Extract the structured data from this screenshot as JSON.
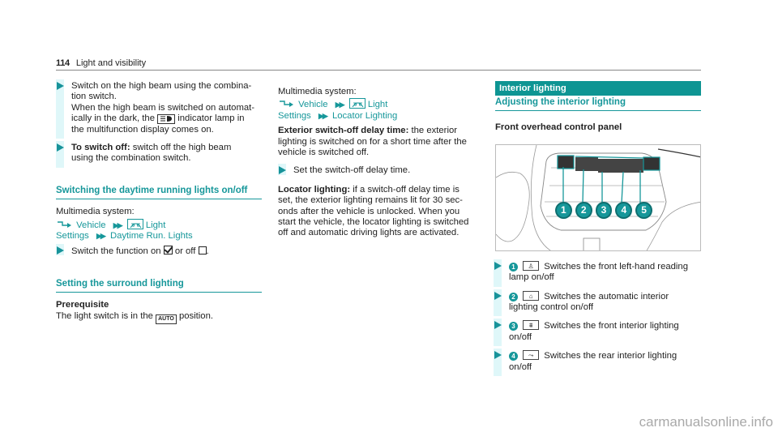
{
  "header": {
    "page_number": "114",
    "section_title": "Light and visibility"
  },
  "column1": {
    "steps_top": [
      {
        "line1": "Switch on the high beam using the combina-",
        "line2": "tion switch.",
        "line3": "When the high beam is switched on automat-",
        "line4_pre": "ically in the dark, the",
        "line4_icon": "high-beam-assist-icon",
        "line4_post": "indicator lamp in",
        "line5": "the multifunction display comes on."
      },
      {
        "bold": "To switch off:",
        "text1": " switch off the high beam",
        "text2": "using the combination switch."
      }
    ],
    "section_daytime": {
      "heading": "Switching the daytime running lights on/off",
      "intro": "Multimedia system:",
      "path": [
        "Vehicle",
        "Light",
        "Settings",
        "Daytime Run. Lights"
      ],
      "step_pre": "Switch the function on",
      "step_mid": "or off",
      "step_post": "."
    },
    "section_surround": {
      "heading": "Setting the surround lighting",
      "prereq_label": "Prerequisite",
      "prereq_pre": "The light switch is in the",
      "prereq_icon_label": "AUTO",
      "prereq_post": "position."
    }
  },
  "column2": {
    "intro": "Multimedia system:",
    "path": [
      "Vehicle",
      "Light",
      "Settings",
      "Locator Lighting"
    ],
    "ext_label": "Exterior switch-off delay time:",
    "ext_lines": [
      " the exterior",
      "lighting is switched on for a short time after the",
      "vehicle is switched off."
    ],
    "step": "Set the switch-off delay time.",
    "loc_label": "Locator lighting:",
    "loc_lines": [
      " if a switch-off delay time is",
      "set, the exterior lighting remains lit for 30 sec-",
      "onds after the vehicle is unlocked. When you",
      "start the vehicle, the locator lighting is switched",
      "off and automatic driving lights are activated."
    ]
  },
  "column3": {
    "banner": "Interior lighting",
    "subheading": "Adjusting the interior lighting",
    "h3": "Front overhead control panel",
    "figure_callouts": [
      "1",
      "2",
      "3",
      "4",
      "5"
    ],
    "items": [
      {
        "num": "1",
        "icon": "reading-lamp-left-icon",
        "line1": "Switches the front left-hand reading",
        "line2": "lamp on/off"
      },
      {
        "num": "2",
        "icon": "auto-interior-lighting-icon",
        "line1": "Switches the automatic interior",
        "line2": "lighting control on/off"
      },
      {
        "num": "3",
        "icon": "front-interior-lighting-icon",
        "line1": "Switches the front interior lighting",
        "line2": "on/off"
      },
      {
        "num": "4",
        "icon": "rear-interior-lighting-icon",
        "line1": "Switches the rear interior lighting",
        "line2": "on/off"
      }
    ]
  },
  "watermark": "carmanualsonline.info",
  "colors": {
    "accent": "#16979a",
    "banner": "#0e9593",
    "step_bar": "#dff7f9"
  }
}
